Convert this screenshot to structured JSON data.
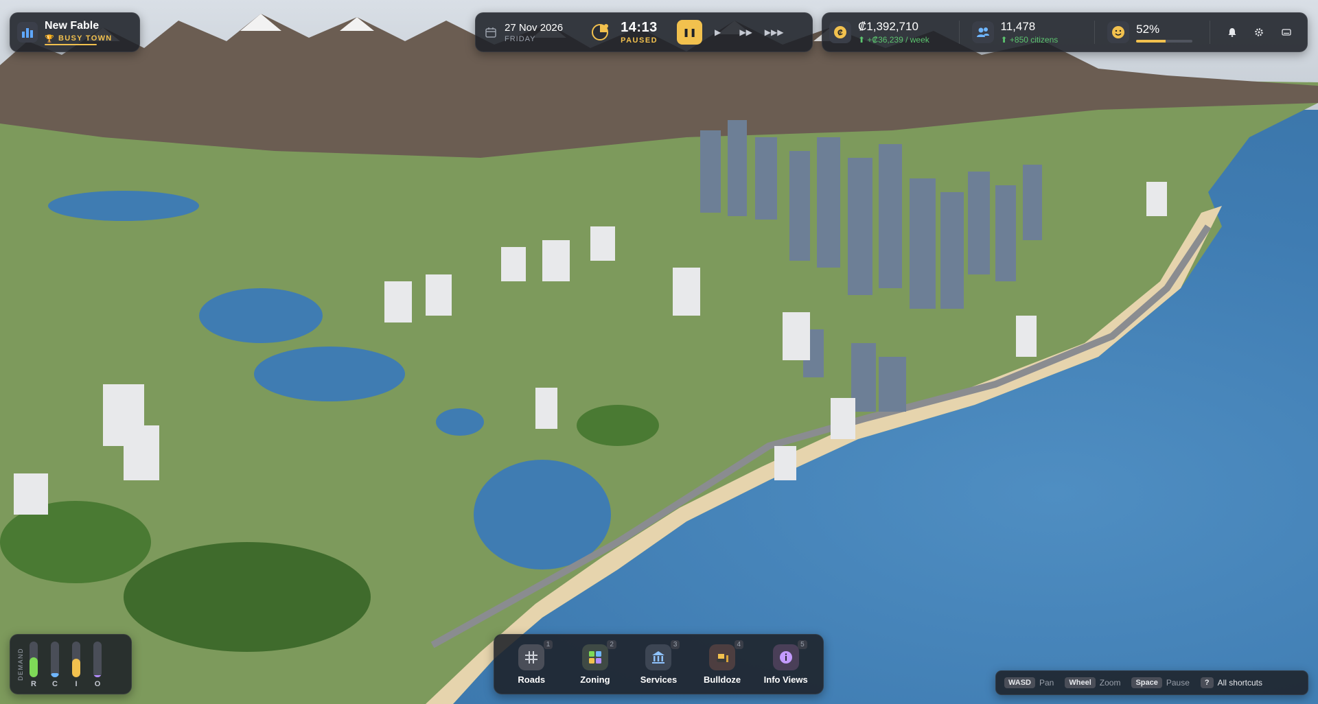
{
  "city": {
    "name": "New Fable",
    "rank": "BUSY TOWN",
    "icon": "city-skyline-icon",
    "rank_icon": "trophy-icon"
  },
  "time": {
    "date": "27 Nov 2026",
    "weekday": "FRIDAY",
    "clock": "14:13",
    "state": "PAUSED",
    "speed_buttons": [
      {
        "icon": "pause-icon",
        "glyph": "❚❚",
        "active": true
      },
      {
        "icon": "play-icon",
        "glyph": "▶",
        "active": false
      },
      {
        "icon": "fast-forward-icon",
        "glyph": "▶▶",
        "active": false
      },
      {
        "icon": "fastest-forward-icon",
        "glyph": "▶▶▶",
        "active": false
      }
    ]
  },
  "stats": {
    "money": {
      "value": "₡1,392,710",
      "delta": "+₡36,239 / week",
      "icon": "coin-icon"
    },
    "population": {
      "value": "11,478",
      "delta": "+850 citizens",
      "icon": "citizens-icon"
    },
    "happiness": {
      "value": "52%",
      "level": 0.52,
      "icon": "smiley-icon"
    }
  },
  "system_icons": [
    "bell-icon",
    "gear-icon",
    "keyboard-icon"
  ],
  "demand": {
    "title": "DEMAND",
    "bars": [
      {
        "letter": "R",
        "level": 0.55,
        "color": "#7ed957"
      },
      {
        "letter": "C",
        "level": 0.12,
        "color": "#6fb6ff"
      },
      {
        "letter": "I",
        "level": 0.52,
        "color": "#f2c14e"
      },
      {
        "letter": "O",
        "level": 0.06,
        "color": "#b58cff"
      }
    ]
  },
  "toolbar": [
    {
      "label": "Roads",
      "key": "1",
      "icon": "roads-icon",
      "bg": "#4a4e58"
    },
    {
      "label": "Zoning",
      "key": "2",
      "icon": "zoning-icon",
      "bg": "#3f4a45"
    },
    {
      "label": "Services",
      "key": "3",
      "icon": "services-icon",
      "bg": "#3d4654"
    },
    {
      "label": "Bulldoze",
      "key": "4",
      "icon": "bulldozer-icon",
      "bg": "#4d3e40"
    },
    {
      "label": "Info Views",
      "key": "5",
      "icon": "info-icon",
      "bg": "#4a3f58"
    }
  ],
  "shortcuts": [
    {
      "key": "WASD",
      "action": "Pan"
    },
    {
      "key": "Wheel",
      "action": "Zoom"
    },
    {
      "key": "Space",
      "action": "Pause"
    },
    {
      "key": "?",
      "action": "All shortcuts"
    }
  ]
}
